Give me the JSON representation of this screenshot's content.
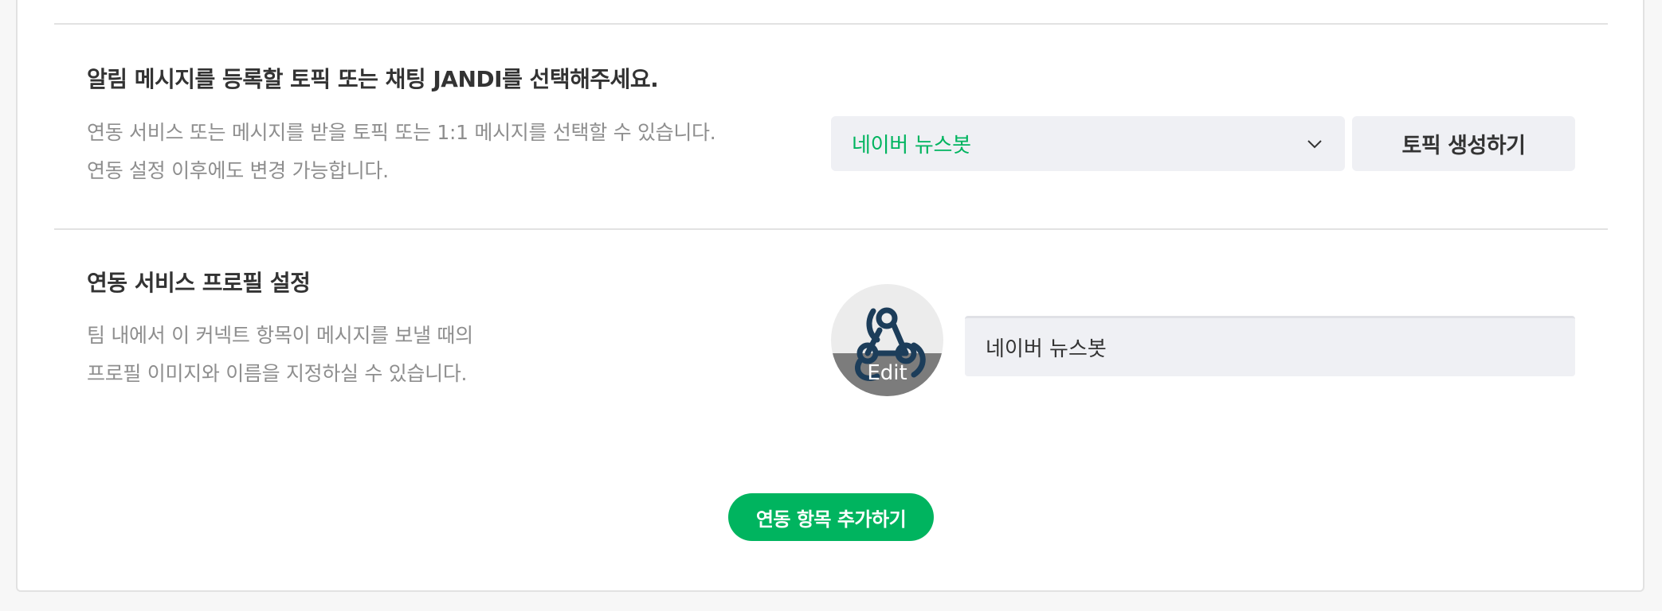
{
  "topic_section": {
    "title": "알림 메시지를 등록할 토픽 또는 채팅 JANDI를 선택해주세요.",
    "desc_line1": "연동 서비스 또는 메시지를 받을 토픽 또는 1:1 메시지를 선택할 수 있습니다.",
    "desc_line2": "연동 설정 이후에도 변경 가능합니다.",
    "select_value": "네이버 뉴스봇",
    "create_topic_label": "토픽 생성하기"
  },
  "profile_section": {
    "title": "연동 서비스 프로필 설정",
    "desc_line1": "팀 내에서 이 커넥트 항목이 메시지를 보낼 때의",
    "desc_line2": "프로필 이미지와 이름을 지정하실 수 있습니다.",
    "avatar_edit_label": "Edit",
    "avatar_icon": "webhook-icon",
    "name_value": "네이버 뉴스봇"
  },
  "add_button_label": "연동 항목 추가하기",
  "colors": {
    "accent": "#00b45f",
    "field_bg": "#eff0f4",
    "divider": "#e2e2e2",
    "muted_text": "#8e8e8e"
  }
}
